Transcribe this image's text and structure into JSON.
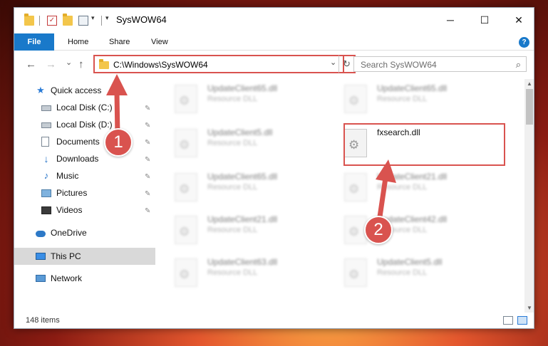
{
  "window": {
    "title": "SysWOW64",
    "minimize": "─",
    "maximize": "☐",
    "close": "✕"
  },
  "ribbon": {
    "file": "File",
    "home": "Home",
    "share": "Share",
    "view": "View",
    "help": "?"
  },
  "nav": {
    "back": "←",
    "forward": "→",
    "recent": "⌄",
    "up": "↑"
  },
  "address": {
    "path": "C:\\Windows\\SysWOW64",
    "chevron": "⌄",
    "refresh": "↻"
  },
  "search": {
    "placeholder": "Search SysWOW64",
    "icon": "search-icon"
  },
  "sidebar": {
    "items": [
      {
        "label": "Quick access",
        "icon": "star-icon"
      },
      {
        "label": "Local Disk (C:)",
        "icon": "drive-icon",
        "pinned": true
      },
      {
        "label": "Local Disk (D:)",
        "icon": "drive-icon",
        "pinned": true
      },
      {
        "label": "Documents",
        "icon": "documents-icon",
        "pinned": true
      },
      {
        "label": "Downloads",
        "icon": "download-icon",
        "pinned": true
      },
      {
        "label": "Music",
        "icon": "music-icon",
        "pinned": true
      },
      {
        "label": "Pictures",
        "icon": "pictures-icon",
        "pinned": true
      },
      {
        "label": "Videos",
        "icon": "videos-icon",
        "pinned": true
      },
      {
        "label": "OneDrive",
        "icon": "onedrive-icon"
      },
      {
        "label": "This PC",
        "icon": "pc-icon",
        "selected": true
      },
      {
        "label": "Network",
        "icon": "network-icon"
      }
    ],
    "pin_glyph": "📌"
  },
  "files": [
    {
      "name": "UpdateClient65.dll",
      "type": "Resource DLL",
      "blurred": true
    },
    {
      "name": "UpdateClient65.dll",
      "type": "Resource DLL",
      "blurred": true
    },
    {
      "name": "UpdateClient5.dll",
      "type": "Resource DLL",
      "blurred": true
    },
    {
      "name": "fxsearch.dll",
      "type": "",
      "blurred": false,
      "highlighted": true
    },
    {
      "name": "UpdateClient65.dll",
      "type": "Resource DLL",
      "blurred": true
    },
    {
      "name": "UpdateClient21.dll",
      "type": "Resource DLL",
      "blurred": true
    },
    {
      "name": "UpdateClient21.dll",
      "type": "Resource DLL",
      "blurred": true
    },
    {
      "name": "UpdateClient42.dll",
      "type": "Resource DLL",
      "blurred": true
    },
    {
      "name": "UpdateClient63.dll",
      "type": "Resource DLL",
      "blurred": true
    },
    {
      "name": "UpdateClient5.dll",
      "type": "Resource DLL",
      "blurred": true
    }
  ],
  "status": {
    "count": "148 items"
  },
  "annotations": {
    "step1": "1",
    "step2": "2",
    "accent": "#d9534f"
  },
  "colors": {
    "ribbon_file": "#1979ca",
    "highlight_border": "#d9534f",
    "selected_nav": "#d9d9d9"
  }
}
